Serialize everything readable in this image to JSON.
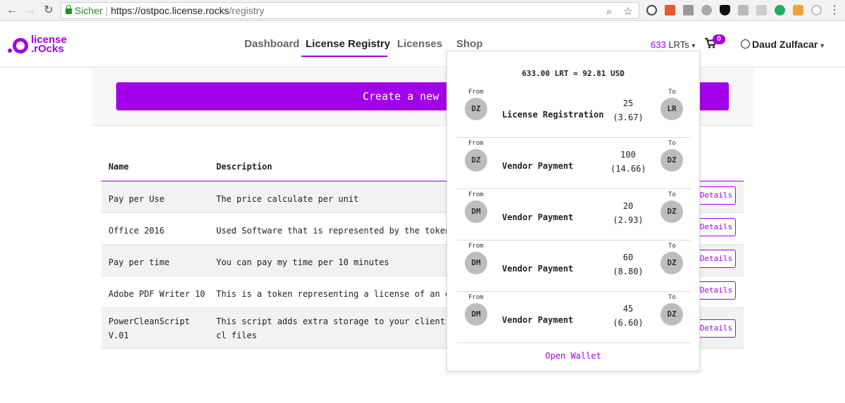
{
  "browser": {
    "secure_label": "Sicher",
    "url_host": "https://ostpoc.license.rocks",
    "url_path": "/registry"
  },
  "navbar": {
    "logo": {
      "line1": "license",
      "line2": ".rOcks"
    },
    "menu": [
      {
        "label": "Dashboard",
        "active": false
      },
      {
        "label": "License Registry",
        "active": true
      },
      {
        "label": "Licenses",
        "active": false
      },
      {
        "label": "Shop",
        "active": false
      }
    ],
    "lrt_count": "633",
    "lrt_unit": "LRTs",
    "cart_count": "0",
    "user_name": "Daud Zulfacar"
  },
  "create_button": {
    "label": "Create a new l"
  },
  "table": {
    "headers": {
      "name": "Name",
      "description": "Description"
    },
    "rows": [
      {
        "name": "Pay per Use",
        "description": "The price calculate per unit",
        "action": "Details"
      },
      {
        "name": "Office 2016",
        "description": "Used Software that is represented by the token",
        "action": "Details"
      },
      {
        "name": "Pay per time",
        "description": "You can pay my time per 10 minutes",
        "action": "Details"
      },
      {
        "name": "Adobe PDF Writer 10",
        "description": "This is a token representing a license of an exis",
        "action": "Details"
      },
      {
        "name": "PowerCleanScript V.01",
        "description": "This script adds extra storage to your client, cl files",
        "action": "Details"
      }
    ]
  },
  "wallet": {
    "balance": "633.00 LRT ≈ 92.81 USD",
    "from_label": "From",
    "to_label": "To",
    "transactions": [
      {
        "from": "DZ",
        "to": "LR",
        "type": "License Registration",
        "amount": "25",
        "usd": "(3.67)"
      },
      {
        "from": "DZ",
        "to": "DZ",
        "type": "Vendor Payment",
        "amount": "100",
        "usd": "(14.66)"
      },
      {
        "from": "DM",
        "to": "DZ",
        "type": "Vendor Payment",
        "amount": "20",
        "usd": "(2.93)"
      },
      {
        "from": "DM",
        "to": "DZ",
        "type": "Vendor Payment",
        "amount": "60",
        "usd": "(8.80)"
      },
      {
        "from": "DM",
        "to": "DZ",
        "type": "Vendor Payment",
        "amount": "45",
        "usd": "(6.60)"
      }
    ],
    "open_wallet": "Open Wallet"
  },
  "colors": {
    "accent": "#a200e8",
    "avatar": "#bdbdbd",
    "row_alt": "#f2f2f2"
  }
}
